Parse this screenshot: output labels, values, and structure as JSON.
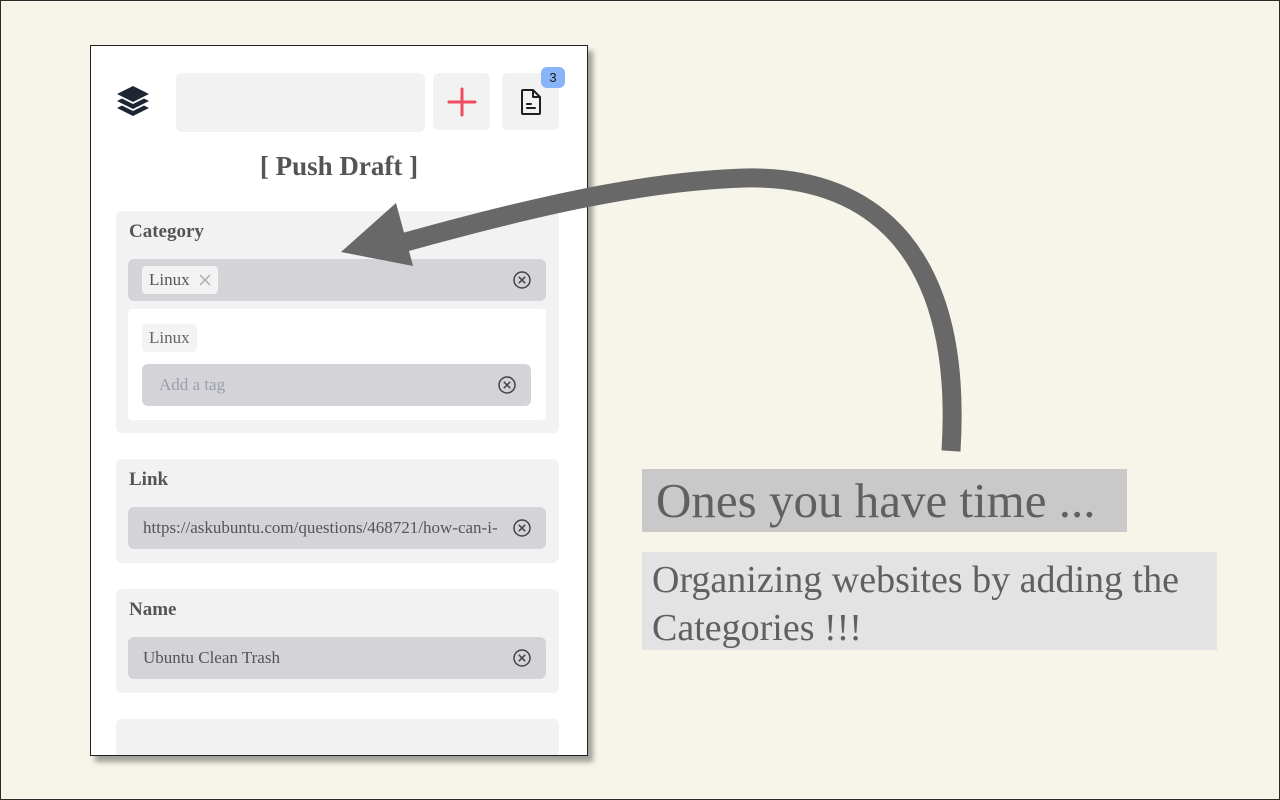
{
  "popup": {
    "title": "[ Push Draft ]",
    "notification_count": "3",
    "icons": {
      "logo": "stacked-layers-icon",
      "add": "plus-icon",
      "drafts": "document-icon",
      "clear": "circle-x-icon",
      "remove_chip": "x-icon"
    },
    "accent_color": "#ef4a5f",
    "badge_color": "#8ab4f8",
    "category": {
      "label": "Category",
      "selected_tags": [
        "Linux"
      ],
      "suggestions": [
        "Linux"
      ],
      "tag_input_placeholder": "Add a tag"
    },
    "link": {
      "label": "Link",
      "value": "https://askubuntu.com/questions/468721/how-can-i-"
    },
    "name": {
      "label": "Name",
      "value": "Ubuntu Clean Trash"
    }
  },
  "captions": {
    "heading": "Ones you have time ...",
    "body": "Organizing websites by adding the Categories !!!"
  }
}
